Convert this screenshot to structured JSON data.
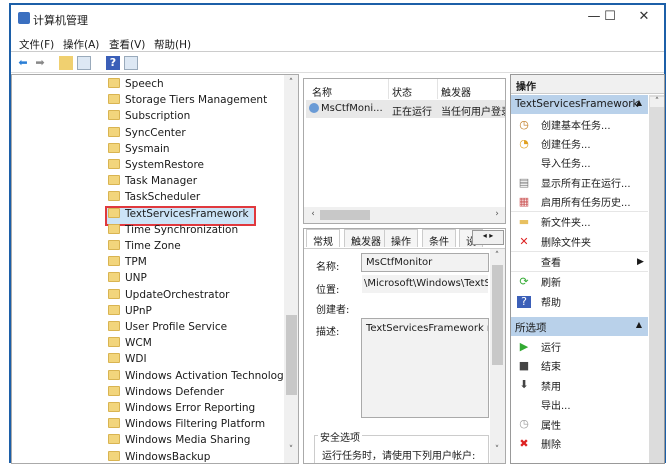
{
  "window": {
    "title": "计算机管理",
    "minimize": "—",
    "maximize": "☐",
    "close": "✕"
  },
  "menu": [
    "文件(F)",
    "操作(A)",
    "查看(V)",
    "帮助(H)"
  ],
  "toolbar": [
    "back-icon",
    "forward-icon",
    "up-folder-icon",
    "show-hide-tree-icon",
    "help-icon",
    "show-action-pane-icon"
  ],
  "tree": {
    "items": [
      "Speech",
      "Storage Tiers Management",
      "Subscription",
      "SyncCenter",
      "Sysmain",
      "SystemRestore",
      "Task Manager",
      "TaskScheduler",
      "TextServicesFramework",
      "Time Synchronization",
      "Time Zone",
      "TPM",
      "UNP",
      "UpdateOrchestrator",
      "UPnP",
      "User Profile Service",
      "WCM",
      "WDI",
      "Windows Activation Technologies",
      "Windows Defender",
      "Windows Error Reporting",
      "Windows Filtering Platform",
      "Windows Media Sharing",
      "WindowsBackup"
    ],
    "selected": "TextServicesFramework",
    "highlight_color": "#e0393e"
  },
  "tasklist": {
    "columns": [
      "名称",
      "状态",
      "触发器"
    ],
    "rows": [
      {
        "name": "MsCtfMoni...",
        "status": "正在运行",
        "trigger": "当任何用户登录"
      }
    ]
  },
  "details": {
    "tabs": [
      "常规",
      "触发器",
      "操作",
      "条件",
      "设"
    ],
    "fields": {
      "name_label": "名称:",
      "name_value": "MsCtfMonitor",
      "location_label": "位置:",
      "location_value": "\\Microsoft\\Windows\\TextServicesFramework",
      "author_label": "创建者:",
      "desc_label": "描述:",
      "desc_value": "TextServicesFramework monitor task"
    },
    "security_title": "安全选项",
    "security_text": "运行任务时，请使用下列用户帐户:"
  },
  "actions": {
    "header": "操作",
    "section1": "TextServicesFramework",
    "items1": [
      "创建基本任务...",
      "创建任务...",
      "导入任务...",
      "显示所有正在运行...",
      "启用所有任务历史...",
      "新文件夹...",
      "删除文件夹",
      "查看",
      "刷新",
      "帮助"
    ],
    "section2": "所选项",
    "items2": [
      "运行",
      "结束",
      "禁用",
      "导出...",
      "属性",
      "删除"
    ]
  }
}
